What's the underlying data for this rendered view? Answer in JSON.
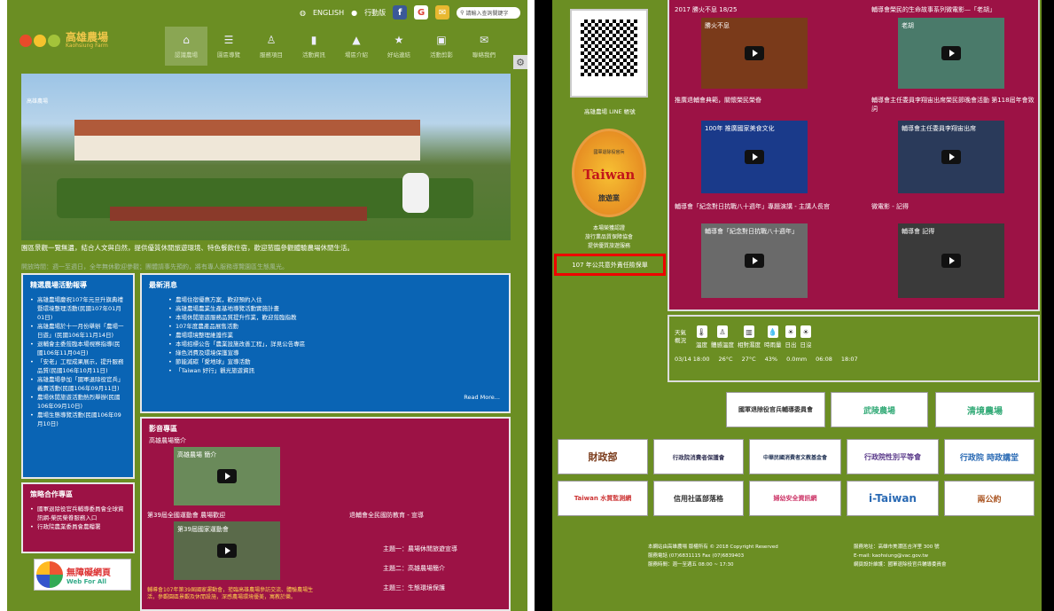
{
  "left": {
    "topbar": {
      "lang": "ENGLISH",
      "mobile": "行動版",
      "search_placeholder": "請輸入查詢關鍵字"
    },
    "logo": {
      "name": "高雄農場",
      "sub": "Kaohsiung Farm"
    },
    "nav": [
      "認識農場",
      "園區導覽",
      "服務項目",
      "活動資訊",
      "場區介紹",
      "好站連結",
      "活動剪影",
      "聯絡我們"
    ],
    "hero_caption": "高雄農場",
    "marquee": "園區景觀一覽無遺，結合人文與自然，提供優質休閒旅遊環境、特色餐飲住宿，歡迎蒞臨參觀體驗農場休閒生活。",
    "marquee2": "開放時間：週一至週日，全年無休歡迎參觀；團體請事先預約，將有專人服務導覽園區生態風光。",
    "activity": {
      "title": "精選農場活動報導",
      "items": [
        "高雄農場慶祝107年元旦升旗典禮暨環境整理活動(民國107年01月01日)",
        "高雄農場於十一月份舉辦「農場一日遊」(民國106年11月14日)",
        "退輔會主委蒞臨本場視察指導(民國106年11月04日)",
        "「安老」工程成果展示，提升服務品質(民國106年10月11日)",
        "高雄農場參加「國軍退除役官兵」義賣活動(民國106年09月11日)",
        "農場休閒旅遊活動熱烈舉辦(民國106年09月10日)",
        "農場生態導覽活動(民國106年09月10日)"
      ]
    },
    "coop": {
      "title": "策略合作專區",
      "items": [
        "國軍退除役官兵輔導委員會全球資訊網-榮民榮眷服務入口",
        "行政院農業委員會農糧署"
      ]
    },
    "news": {
      "title": "最新消息",
      "items": [
        "農場住宿優惠方案，歡迎預約入住",
        "高雄農場農業生產基地導覽活動實施計畫",
        "本場休閒旅遊服務品質提升作業，歡迎蒞臨指教",
        "107年度農產品展售活動",
        "農場環境整理維護作業",
        "本場招標公告「農業設施改善工程」，詳見公告專區",
        "綠色消費及環境保護宣導",
        "節能減碳「愛地球」宣導活動",
        "「Taiwan 好行」觀光旅遊資訊"
      ],
      "more": "Read More..."
    },
    "media": {
      "title": "影音專區",
      "sub": "高雄農場簡介",
      "video1": "高雄農場 簡介",
      "video2": "第39屆國家運動會",
      "cap1": "第39屆全國運動會 農場歡迎",
      "cap2": "退輔會全民國防教育 - 宣導",
      "list": [
        "主題一：農場休閒旅遊宣導",
        "主題二：高雄農場簡介",
        "主題三：生態環境保護"
      ],
      "desc": "輔導會107年第39屆國家運動會，蒞臨高雄農場參訪交流、體驗農場生活，參觀園區景觀及休閒設施，深感農場環境優美，寓教於樂。"
    },
    "access": {
      "t1": "無障礙網頁",
      "t2": "Web For All"
    }
  },
  "right": {
    "qr_caption": "高雄農場 LINE 帳號",
    "seal": {
      "top": "國軍退除役官兵",
      "brand": "Taiwan",
      "bot": "旅遊業"
    },
    "seal_text": [
      "本場榮獲認證",
      "旅行業品質保障協會",
      "提供優質旅遊服務"
    ],
    "red_label": "107 年公共意外責任險保單",
    "videos": [
      {
        "title": "2017 勝火不息 18/25",
        "overlay": "勝火不息",
        "caption": "推廣退輔會典範，關懷榮民榮眷"
      },
      {
        "title": "輔導會榮民的生命故事系列微電影—「老胡」",
        "overlay": "老胡",
        "caption": "輔導會主任委員李翔宙出席榮民節晚會活動 第118屆年會致詞"
      },
      {
        "title": "",
        "overlay": "100年 推廣國家美食文化",
        "caption": "輔導會「紀念對日抗戰八十週年」專題演講 - 主講人長官"
      },
      {
        "title": "",
        "overlay": "輔導會主任委員李翔宙出席",
        "caption": "微電影 - 記得"
      },
      {
        "title": "",
        "overlay": "輔導會「紀念對日抗戰八十週年」",
        "caption": ""
      },
      {
        "title": "",
        "overlay": "輔導會 記得",
        "caption": ""
      }
    ],
    "weather": {
      "label": "天氣 概況",
      "cols": [
        "溫度",
        "體感溫度",
        "相對濕度",
        "時雨量",
        "日出",
        "日沒"
      ],
      "date": "03/14 18:00",
      "vals": [
        "26°C",
        "27°C",
        "43%",
        "0.0mm",
        "06:08",
        "18:07"
      ]
    },
    "banners": [
      "國軍退除役官兵輔導委員會",
      "武陵農場",
      "清境農場",
      "財政部",
      "行政院消費者保護會",
      "中華民國消費者文教基金會",
      "行政院性別平等會",
      "行政院 時政講堂",
      "Taiwan 水質監測網",
      "信用社區部落格",
      "婦幼安全資訊網",
      "i-Taiwan",
      "兩公約"
    ],
    "footer_left": [
      "本網站由高雄農場 版權所有 © 2018 Copyright Reserved",
      "服務電話 (07)6831115  Fax (07)6839403",
      "服務時間：週一至週五 08:00 ~ 17:30"
    ],
    "footer_right": [
      "服務地址：高雄市美濃區吉洋里 300 號",
      "E-mail: kaohsiung@vac.gov.tw",
      "網頁設計維護：國軍退除役官兵輔導委員會"
    ]
  }
}
